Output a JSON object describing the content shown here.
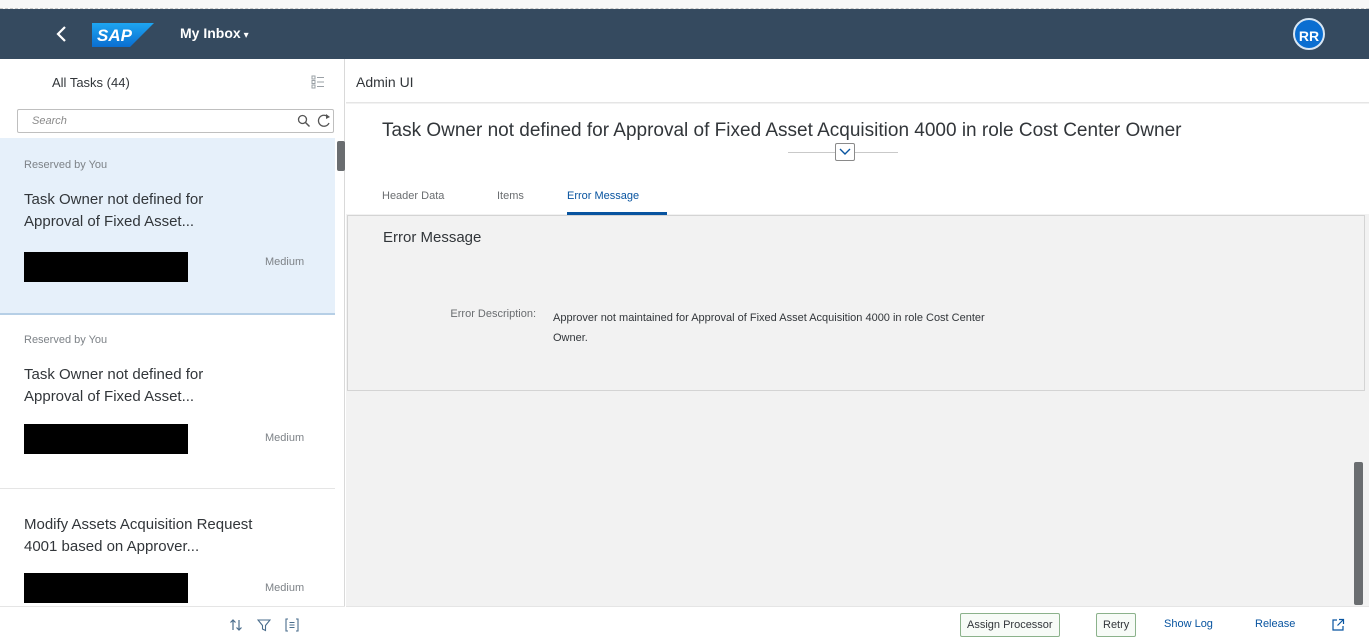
{
  "shell": {
    "back_icon": "back-chevron-icon",
    "logo_text": "SAP",
    "app_title": "My Inbox",
    "title_caret": "▾",
    "avatar_initials": "RR",
    "colors": {
      "shell_bg": "#354a5f",
      "avatar_bg": "#0a6ed1",
      "logo_bg": "#0a6ed1"
    }
  },
  "master": {
    "title": "All Tasks (44)",
    "multi_select_icon": "multi-select-icon",
    "search": {
      "placeholder": "Search",
      "search_icon": "search-icon",
      "refresh_icon": "refresh-icon"
    },
    "items": [
      {
        "status": "Reserved by You",
        "title_line1": "Task Owner not defined for",
        "title_line2": "Approval of Fixed Asset...",
        "priority": "Medium",
        "selected": true
      },
      {
        "status": "Reserved by You",
        "title_line1": "Task Owner not defined for",
        "title_line2": "Approval of Fixed Asset...",
        "priority": "Medium",
        "selected": false
      },
      {
        "status": "",
        "title_line1": "Modify Assets Acquisition Request",
        "title_line2": "4001 based on Approver...",
        "priority": "Medium",
        "selected": false
      }
    ],
    "footer_icons": [
      "sort-icon",
      "filter-icon",
      "group-icon"
    ]
  },
  "detail": {
    "app_name": "Admin UI",
    "object_title": "Task Owner not defined for Approval of Fixed Asset Acquisition 4000 in role Cost Center Owner",
    "collapse_icon": "chevron-down-icon",
    "tabs": [
      {
        "label": "Header Data",
        "active": false
      },
      {
        "label": "Items",
        "active": false
      },
      {
        "label": "Error Message",
        "active": true
      }
    ],
    "section": {
      "title": "Error Message",
      "field_label": "Error Description:",
      "field_value_line1": "Approver not maintained for Approval of Fixed Asset Acquisition 4000 in role Cost Center",
      "field_value_line2": "Owner."
    }
  },
  "footer": {
    "assign_processor": "Assign Processor",
    "retry": "Retry",
    "show_log": "Show Log",
    "release": "Release",
    "share_icon": "share-icon"
  }
}
